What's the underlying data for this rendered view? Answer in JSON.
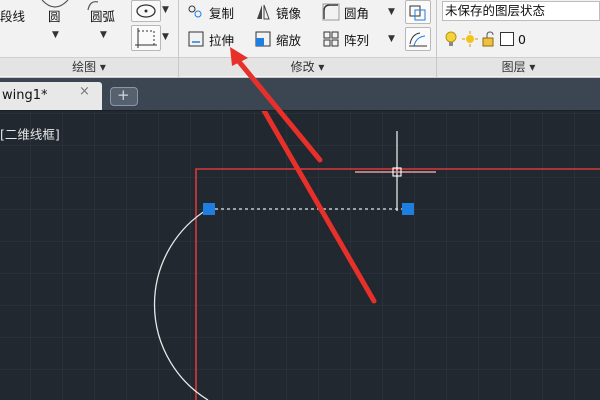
{
  "ribbon": {
    "draw_panel": {
      "title": "绘图",
      "polyline_label": "段线",
      "circle_label": "圆",
      "arc_label": "圆弧"
    },
    "modify_panel": {
      "title": "修改",
      "copy_label": "复制",
      "mirror_label": "镜像",
      "fillet_label": "圆角",
      "stretch_label": "拉伸",
      "scale_label": "缩放",
      "array_label": "阵列"
    },
    "layers_panel": {
      "title": "图层",
      "layer_state": "未保存的图层状态",
      "current_layer": "0"
    }
  },
  "tabs": {
    "file_tab_label": "wing1*",
    "close_glyph": "×",
    "new_tab_glyph": "+"
  },
  "canvas": {
    "view_label": "[二维线框]"
  },
  "colors": {
    "canvas_bg": "#212830",
    "boundary_red": "#d63a3a",
    "grip_blue": "#1e7fe0",
    "annotation_arrow": "#e8302a"
  }
}
